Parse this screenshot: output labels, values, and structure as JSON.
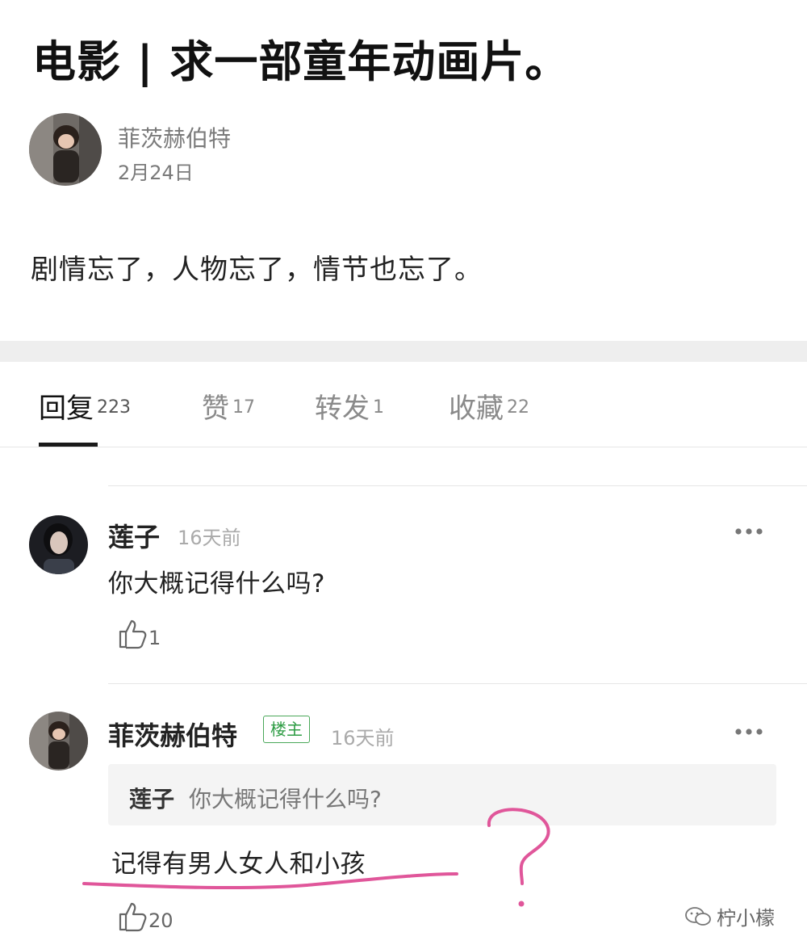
{
  "post": {
    "title": "电影 | 求一部童年动画片。",
    "author": "菲茨赫伯特",
    "date": "2月24日",
    "body": "剧情忘了，人物忘了，情节也忘了。"
  },
  "tabs": [
    {
      "label": "回复",
      "count": "223",
      "active": true
    },
    {
      "label": "赞",
      "count": "17"
    },
    {
      "label": "转发",
      "count": "1"
    },
    {
      "label": "收藏",
      "count": "22"
    }
  ],
  "comments": [
    {
      "name": "莲子",
      "time": "16天前",
      "text": "你大概记得什么吗?",
      "likes": "1",
      "icons": [
        "more-icon",
        "thumbs-up-icon"
      ]
    },
    {
      "name": "菲茨赫伯特",
      "badge": "楼主",
      "time": "16天前",
      "quote": {
        "name": "莲子",
        "text": "你大概记得什么吗?"
      },
      "text": "记得有男人女人和小孩",
      "likes": "20",
      "icons": [
        "more-icon",
        "thumbs-up-icon"
      ]
    }
  ],
  "watermark": {
    "text": "柠小檬",
    "icon": "wechat-icon"
  },
  "colors": {
    "op_badge": "#2f9d45",
    "annotation": "#e0569a",
    "divider": "#eeeeee"
  }
}
